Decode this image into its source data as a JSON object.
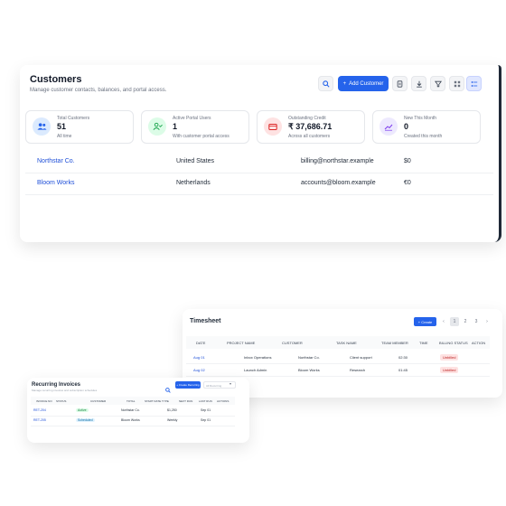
{
  "customers": {
    "title": "Customers",
    "subtitle": "Manage customer contacts, balances, and portal access.",
    "add_label": "Add Customer",
    "stats": [
      {
        "label": "Total Customers",
        "value": "51",
        "sub": "All time"
      },
      {
        "label": "Active Portal Users",
        "value": "1",
        "sub": "With customer portal access"
      },
      {
        "label": "Outstanding Credit",
        "value": "₹ 37,686.71",
        "sub": "Across all customers"
      },
      {
        "label": "New This Month",
        "value": "0",
        "sub": "Created this month"
      }
    ],
    "rows": [
      {
        "name": "Northstar Co.",
        "country": "United States",
        "email": "billing@northstar.example",
        "balance": "$0"
      },
      {
        "name": "Bloom Works",
        "country": "Netherlands",
        "email": "accounts@bloom.example",
        "balance": "€0"
      }
    ]
  },
  "timesheet": {
    "title": "Timesheet",
    "create_label": "Create",
    "pages": [
      "‹",
      "1",
      "2",
      "3",
      "›"
    ],
    "columns": [
      "DATE",
      "PROJECT NAME",
      "CUSTOMER",
      "TASK NAME",
      "TEAM MEMBER",
      "TIME",
      "BILLING STATUS",
      "ACTION"
    ],
    "rows": [
      {
        "date": "Aug 01",
        "project": "Inbox Operations",
        "customer": "Northstar Co.",
        "task": "Client support",
        "time": "02:30",
        "status": "Unbilled"
      },
      {
        "date": "Aug 02",
        "project": "Launch Admin",
        "customer": "Bloom Works",
        "task": "Research",
        "time": "01:45",
        "status": "Unbilled"
      }
    ]
  },
  "recurring": {
    "title": "Recurring Invoices",
    "subtitle": "Manage recurring invoices and subscription schedules",
    "create_label": "Create Recurring",
    "filter_placeholder": "All Recurring",
    "columns": [
      "INVOICE NO",
      "STATUS",
      "CUSTOMER",
      "TOTAL",
      "START DATE",
      "TYPE",
      "NEXT RUN",
      "LAST RUN",
      "ACTIONS"
    ],
    "rows": [
      {
        "no": "RET-204",
        "status": "Active",
        "customer": "Northstar Co.",
        "total": "$1,250",
        "type": "Monthly",
        "last": "Sep 01"
      },
      {
        "no": "RET-205",
        "status": "Scheduled",
        "customer": "Bloom Works",
        "total": "€800",
        "type": "Weekly",
        "last": "Sep 01"
      }
    ]
  }
}
